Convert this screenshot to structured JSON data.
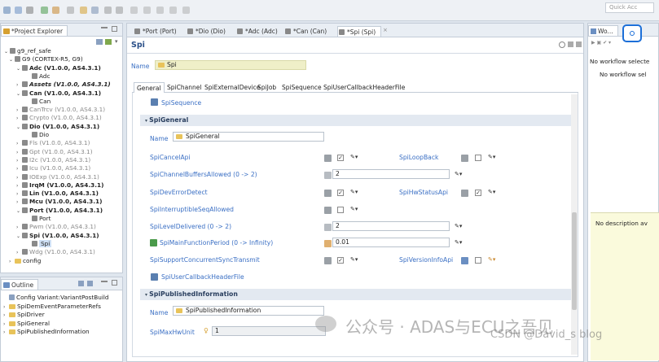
{
  "toolbar": {
    "quick_access": "Quick Acc"
  },
  "explorer": {
    "tab_label": "*Project Explorer",
    "tree": [
      {
        "label": "g9_ref_safe",
        "level": 0,
        "twisty": "v",
        "style": ""
      },
      {
        "label": "G9 (CORTEX-R5, G9)",
        "level": 1,
        "twisty": "v",
        "style": ""
      },
      {
        "label": "Adc (V1.0.0, AS4.3.1)",
        "level": 2,
        "twisty": "v",
        "style": "bold"
      },
      {
        "label": "Adc",
        "level": 3,
        "twisty": "",
        "style": ""
      },
      {
        "label": "Assets (V1.0.0, AS4.3.1)",
        "level": 2,
        "twisty": ">",
        "style": "bold ital"
      },
      {
        "label": "Can (V1.0.0, AS4.3.1)",
        "level": 2,
        "twisty": "v",
        "style": "bold"
      },
      {
        "label": "Can",
        "level": 3,
        "twisty": "",
        "style": ""
      },
      {
        "label": "CanTrcv (V1.0.0, AS4.3.1)",
        "level": 2,
        "twisty": ">",
        "style": "gray"
      },
      {
        "label": "Crypto (V1.0.0, AS4.3.1)",
        "level": 2,
        "twisty": ">",
        "style": "gray"
      },
      {
        "label": "Dio (V1.0.0, AS4.3.1)",
        "level": 2,
        "twisty": "v",
        "style": "bold"
      },
      {
        "label": "Dio",
        "level": 3,
        "twisty": "",
        "style": ""
      },
      {
        "label": "Fls (V1.0.0, AS4.3.1)",
        "level": 2,
        "twisty": ">",
        "style": "gray"
      },
      {
        "label": "Gpt (V1.0.0, AS4.3.1)",
        "level": 2,
        "twisty": ">",
        "style": "gray"
      },
      {
        "label": "I2c (V1.0.0, AS4.3.1)",
        "level": 2,
        "twisty": ">",
        "style": "gray"
      },
      {
        "label": "Icu (V1.0.0, AS4.3.1)",
        "level": 2,
        "twisty": ">",
        "style": "gray"
      },
      {
        "label": "IOExp (V1.0.0, AS4.3.1)",
        "level": 2,
        "twisty": ">",
        "style": "gray"
      },
      {
        "label": "IrqM (V1.0.0, AS4.3.1)",
        "level": 2,
        "twisty": ">",
        "style": "bold"
      },
      {
        "label": "Lin (V1.0.0, AS4.3.1)",
        "level": 2,
        "twisty": ">",
        "style": "bold"
      },
      {
        "label": "Mcu (V1.0.0, AS4.3.1)",
        "level": 2,
        "twisty": ">",
        "style": "bold"
      },
      {
        "label": "Port (V1.0.0, AS4.3.1)",
        "level": 2,
        "twisty": "v",
        "style": "bold"
      },
      {
        "label": "Port",
        "level": 3,
        "twisty": "",
        "style": ""
      },
      {
        "label": "Pwm (V1.0.0, AS4.3.1)",
        "level": 2,
        "twisty": ">",
        "style": "gray"
      },
      {
        "label": "Spi (V1.0.0, AS4.3.1)",
        "level": 2,
        "twisty": "v",
        "style": "bold"
      },
      {
        "label": "Spi",
        "level": 3,
        "twisty": "",
        "style": "selected"
      },
      {
        "label": "Wdg (V1.0.0, AS4.3.1)",
        "level": 2,
        "twisty": ">",
        "style": "gray"
      },
      {
        "label": "config",
        "level": 1,
        "twisty": ">",
        "style": "folder"
      }
    ]
  },
  "outline": {
    "tab_label": "Outline",
    "items": [
      {
        "label": "Config Variant:VariantPostBuild",
        "icon": "doc"
      },
      {
        "label": "SpiDemEventParameterRefs",
        "icon": "folder"
      },
      {
        "label": "SpiDriver",
        "icon": "folder"
      },
      {
        "label": "SpiGeneral",
        "icon": "folder"
      },
      {
        "label": "SpiPublishedInformation",
        "icon": "folder"
      }
    ]
  },
  "editor_tabs": [
    {
      "label": "*Port (Port)",
      "active": false
    },
    {
      "label": "*Dio (Dio)",
      "active": false
    },
    {
      "label": "*Adc (Adc)",
      "active": false
    },
    {
      "label": "*Can (Can)",
      "active": false
    },
    {
      "label": "*Spi (Spi)",
      "active": true
    }
  ],
  "editor": {
    "title": "Spi",
    "name_label": "Name",
    "name_value": "Spi",
    "subtabs": [
      "General",
      "SpiChannel",
      "SpiExternalDevice",
      "SpiJob",
      "SpiSequence",
      "SpiUserCallbackHeaderFile"
    ],
    "spi_sequence_link": "SpiSequence",
    "general": {
      "header": "SpiGeneral",
      "name_label": "Name",
      "name_value": "SpiGeneral",
      "cancel_api": "SpiCancelApi",
      "loop_back": "SpiLoopBack",
      "channel_buffers": "SpiChannelBuffersAllowed (0 -> 2)",
      "channel_buffers_value": "2",
      "dev_error_detect": "SpiDevErrorDetect",
      "hw_status_api": "SpiHwStatusApi",
      "interruptible_seq": "SpiInterruptibleSeqAllowed",
      "level_delivered": "SpiLevelDelivered (0 -> 2)",
      "level_delivered_value": "2",
      "main_function_period": "SpiMainFunctionPeriod (0 -> Infinity)",
      "main_function_period_value": "0.01",
      "support_concurrent": "SpiSupportConcurrentSyncTransmit",
      "version_info_api": "SpiVersionInfoApi",
      "user_callback_header": "SpiUserCallbackHeaderFile"
    },
    "published": {
      "header": "SpiPublishedInformation",
      "name_label": "Name",
      "name_value": "SpiPublishedInformation",
      "max_hw_unit": "SpiMaxHwUnit",
      "max_hw_unit_value": "1"
    }
  },
  "workflow": {
    "tab_label": "Wo...",
    "message1": "No workflow selecte",
    "message2": "No workflow sel",
    "description": "No description av"
  },
  "watermark": {
    "text1": "公众号 · ADAS与ECU之吾见",
    "text2": "CSDN @David_s blog"
  }
}
